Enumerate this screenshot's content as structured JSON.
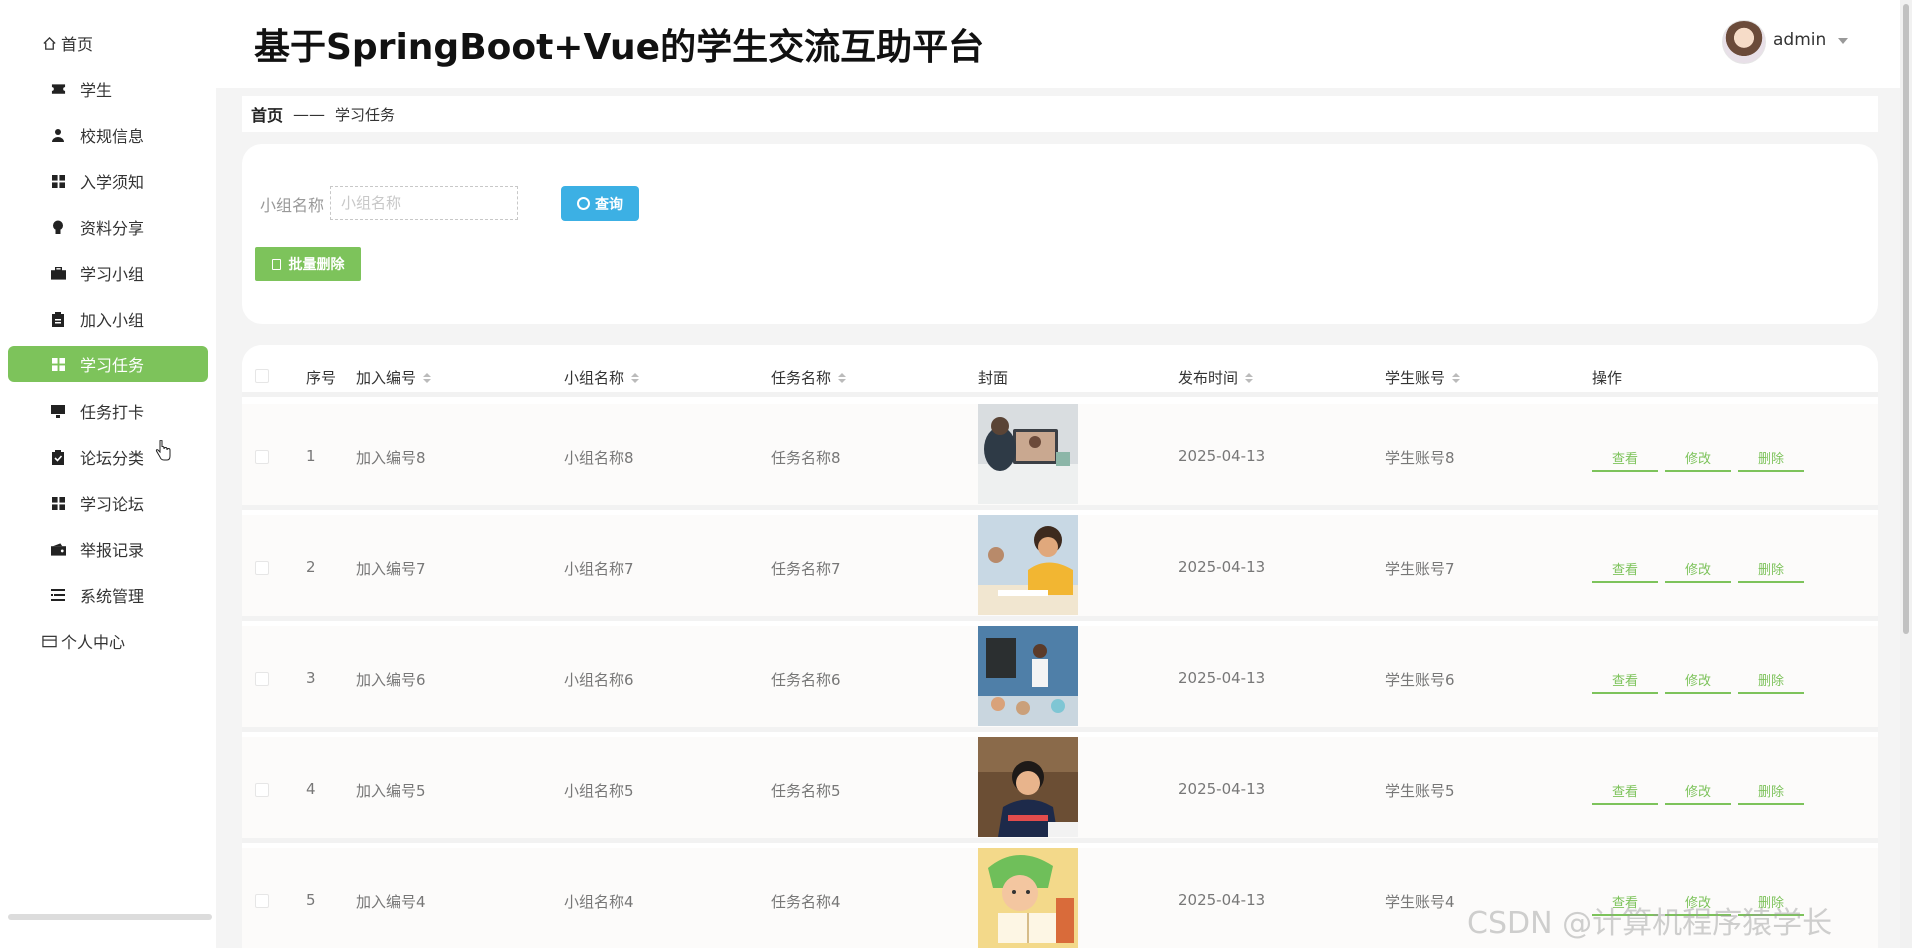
{
  "header": {
    "title": "基于SpringBoot+Vue的学生交流互助平台",
    "user_name": "admin"
  },
  "sidebar": {
    "items": [
      {
        "label": "首页",
        "icon": "home-icon"
      },
      {
        "label": "学生",
        "icon": "ticket-icon"
      },
      {
        "label": "校规信息",
        "icon": "user-icon"
      },
      {
        "label": "入学须知",
        "icon": "grid-icon"
      },
      {
        "label": "资料分享",
        "icon": "bulb-icon"
      },
      {
        "label": "学习小组",
        "icon": "briefcase-icon"
      },
      {
        "label": "加入小组",
        "icon": "clipboard-icon"
      },
      {
        "label": "学习任务",
        "icon": "grid-icon"
      },
      {
        "label": "任务打卡",
        "icon": "monitor-icon"
      },
      {
        "label": "论坛分类",
        "icon": "checklist-icon"
      },
      {
        "label": "学习论坛",
        "icon": "grid-icon"
      },
      {
        "label": "举报记录",
        "icon": "wallet-icon"
      },
      {
        "label": "系统管理",
        "icon": "list-icon"
      },
      {
        "label": "个人中心",
        "icon": "card-icon"
      }
    ],
    "active_index": 7
  },
  "breadcrumb": {
    "home": "首页",
    "separator": "——",
    "current": "学习任务"
  },
  "search": {
    "label": "小组名称",
    "placeholder": "小组名称",
    "value": "",
    "query_button": "查询",
    "batch_delete_button": "批量删除"
  },
  "table": {
    "columns": [
      "序号",
      "加入编号",
      "小组名称",
      "任务名称",
      "封面",
      "发布时间",
      "学生账号",
      "操作"
    ],
    "rows": [
      {
        "index": "1",
        "join_no": "加入编号8",
        "group": "小组名称8",
        "task": "任务名称8",
        "date": "2025-04-13",
        "account": "学生账号8",
        "cover": "student-laptop"
      },
      {
        "index": "2",
        "join_no": "加入编号7",
        "group": "小组名称7",
        "task": "任务名称7",
        "date": "2025-04-13",
        "account": "学生账号7",
        "cover": "boy-writing"
      },
      {
        "index": "3",
        "join_no": "加入编号6",
        "group": "小组名称6",
        "task": "任务名称6",
        "date": "2025-04-13",
        "account": "学生账号6",
        "cover": "teacher-classroom"
      },
      {
        "index": "4",
        "join_no": "加入编号5",
        "group": "小组名称5",
        "task": "任务名称5",
        "date": "2025-04-13",
        "account": "学生账号5",
        "cover": "boy-studying"
      },
      {
        "index": "5",
        "join_no": "加入编号4",
        "group": "小组名称4",
        "task": "任务名称4",
        "date": "2025-04-13",
        "account": "学生账号4",
        "cover": "cartoon-reading"
      }
    ],
    "actions": [
      "查看",
      "修改",
      "删除"
    ]
  },
  "watermark": "CSDN @计算机程序猿学长",
  "colors": {
    "accent_green": "#7dc35b",
    "query_blue": "#3cb0e4"
  }
}
